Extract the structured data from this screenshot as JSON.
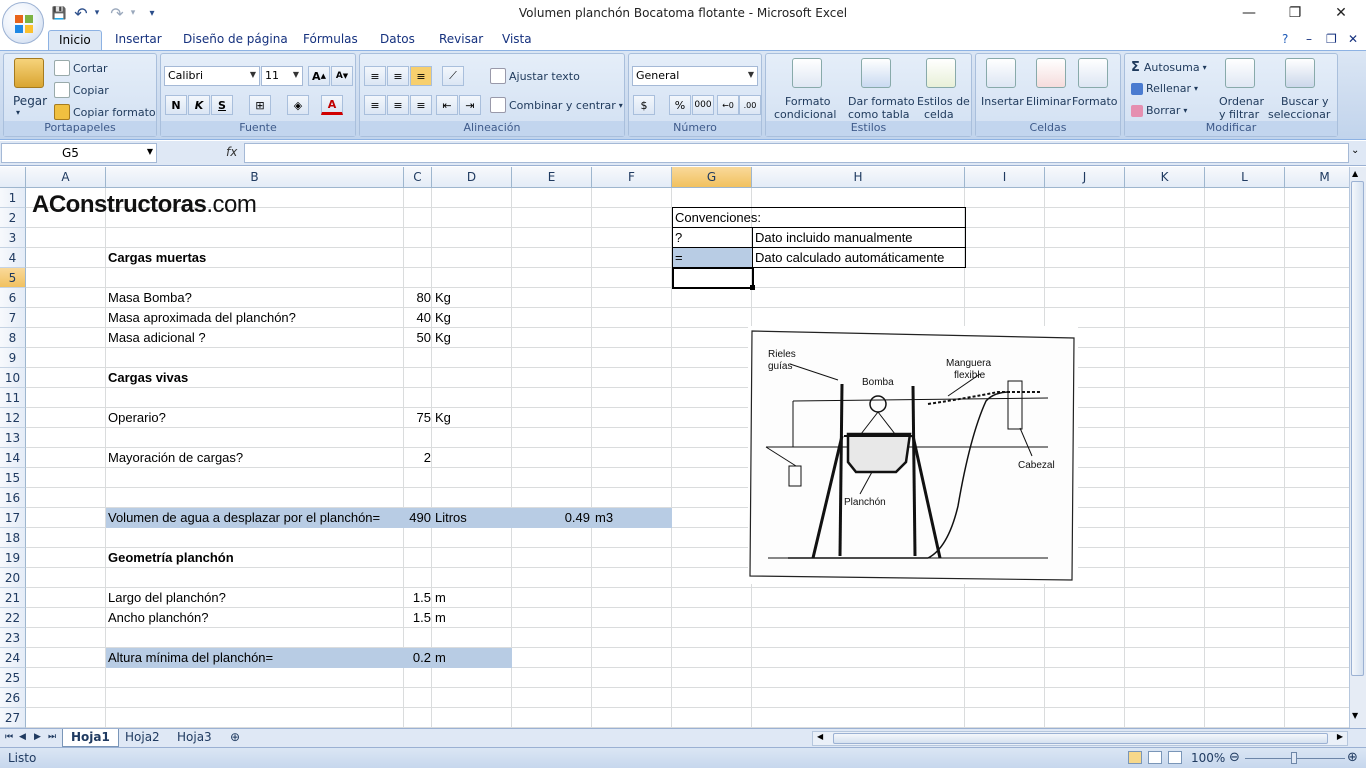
{
  "window": {
    "title": "Volumen planchón Bocatoma flotante - Microsoft Excel",
    "minimize": "—",
    "restore": "❐",
    "close": "✕"
  },
  "quick_access": {
    "save": "💾",
    "undo": "↶",
    "redo": "↷",
    "customize": "▾"
  },
  "ribbon_tabs": [
    "Inicio",
    "Insertar",
    "Diseño de página",
    "Fórmulas",
    "Datos",
    "Revisar",
    "Vista"
  ],
  "active_tab": "Inicio",
  "ribbon": {
    "clipboard": {
      "paste": "Pegar",
      "cut": "Cortar",
      "copy": "Copiar",
      "format_painter": "Copiar formato",
      "label": "Portapapeles"
    },
    "font": {
      "name": "Calibri",
      "size": "11",
      "bold": "N",
      "italic": "K",
      "underline": "S",
      "label": "Fuente"
    },
    "alignment": {
      "wrap": "Ajustar texto",
      "merge": "Combinar y centrar",
      "label": "Alineación"
    },
    "number": {
      "format": "General",
      "currency": "$",
      "percent": "%",
      "thousands": "000",
      "label": "Número"
    },
    "styles": {
      "conditional_1": "Formato",
      "conditional_2": "condicional",
      "table_1": "Dar formato",
      "table_2": "como tabla",
      "cell_1": "Estilos de",
      "cell_2": "celda",
      "label": "Estilos"
    },
    "cells": {
      "insert": "Insertar",
      "delete": "Eliminar",
      "format": "Formato",
      "label": "Celdas"
    },
    "editing": {
      "autosum": "Autosuma",
      "fill": "Rellenar",
      "clear": "Borrar",
      "sort_1": "Ordenar",
      "sort_2": "y filtrar",
      "find_1": "Buscar y",
      "find_2": "seleccionar",
      "label": "Modificar"
    }
  },
  "formula_bar": {
    "name_box": "G5",
    "fx": "fx",
    "formula": ""
  },
  "columns": [
    "A",
    "B",
    "C",
    "D",
    "E",
    "F",
    "G",
    "H",
    "I",
    "J",
    "K",
    "L",
    "M"
  ],
  "selected_column": "G",
  "rows": [
    "1",
    "2",
    "3",
    "4",
    "5",
    "6",
    "7",
    "8",
    "9",
    "10",
    "11",
    "12",
    "13",
    "14",
    "15",
    "16",
    "17",
    "18",
    "19",
    "20",
    "21",
    "22",
    "23",
    "24",
    "25",
    "26",
    "27"
  ],
  "selected_row": "5",
  "logo": {
    "brand": "AConstructoras",
    "suffix": ".com"
  },
  "cells": {
    "b4": "Cargas muertas",
    "b6": "Masa Bomba?",
    "c6": "80",
    "d6": "Kg",
    "b7": "Masa aproximada del planchón?",
    "c7": "40",
    "d7": "Kg",
    "b8": "Masa adicional ?",
    "c8": "50",
    "d8": "Kg",
    "b10": "Cargas vivas",
    "b12": "Operario?",
    "c12": "75",
    "d12": "Kg",
    "b14": "Mayoración de cargas?",
    "c14": "2",
    "b17": "Volumen de agua a desplazar por el planchón=",
    "c17": "490",
    "d17": "Litros",
    "e17": "0.49",
    "f17": "m3",
    "b19": "Geometría planchón",
    "b21": "Largo del planchón?",
    "c21": "1.5",
    "d21": "m",
    "b22": "Ancho planchón?",
    "c22": "1.5",
    "d22": "m",
    "b24": "Altura mínima del planchón=",
    "c24": "0.2",
    "d24": "m",
    "g2": "Convenciones:",
    "g3": "?",
    "h3": "Dato incluido manualmente",
    "g4": "=",
    "h4": "Dato calculado automáticamente"
  },
  "diagram": {
    "rails": "Rieles",
    "guides": "guías",
    "pump": "Bomba",
    "hose_1": "Manguera",
    "hose_2": "flexible",
    "head": "Cabezal",
    "raft": "Planchón"
  },
  "sheets": [
    "Hoja1",
    "Hoja2",
    "Hoja3"
  ],
  "active_sheet": "Hoja1",
  "status": {
    "text": "Listo",
    "zoom": "100%"
  },
  "colors": {
    "calc_fill": "#b8cce4",
    "selection": "#f1c15f",
    "ribbon": "#c9d9ee"
  }
}
